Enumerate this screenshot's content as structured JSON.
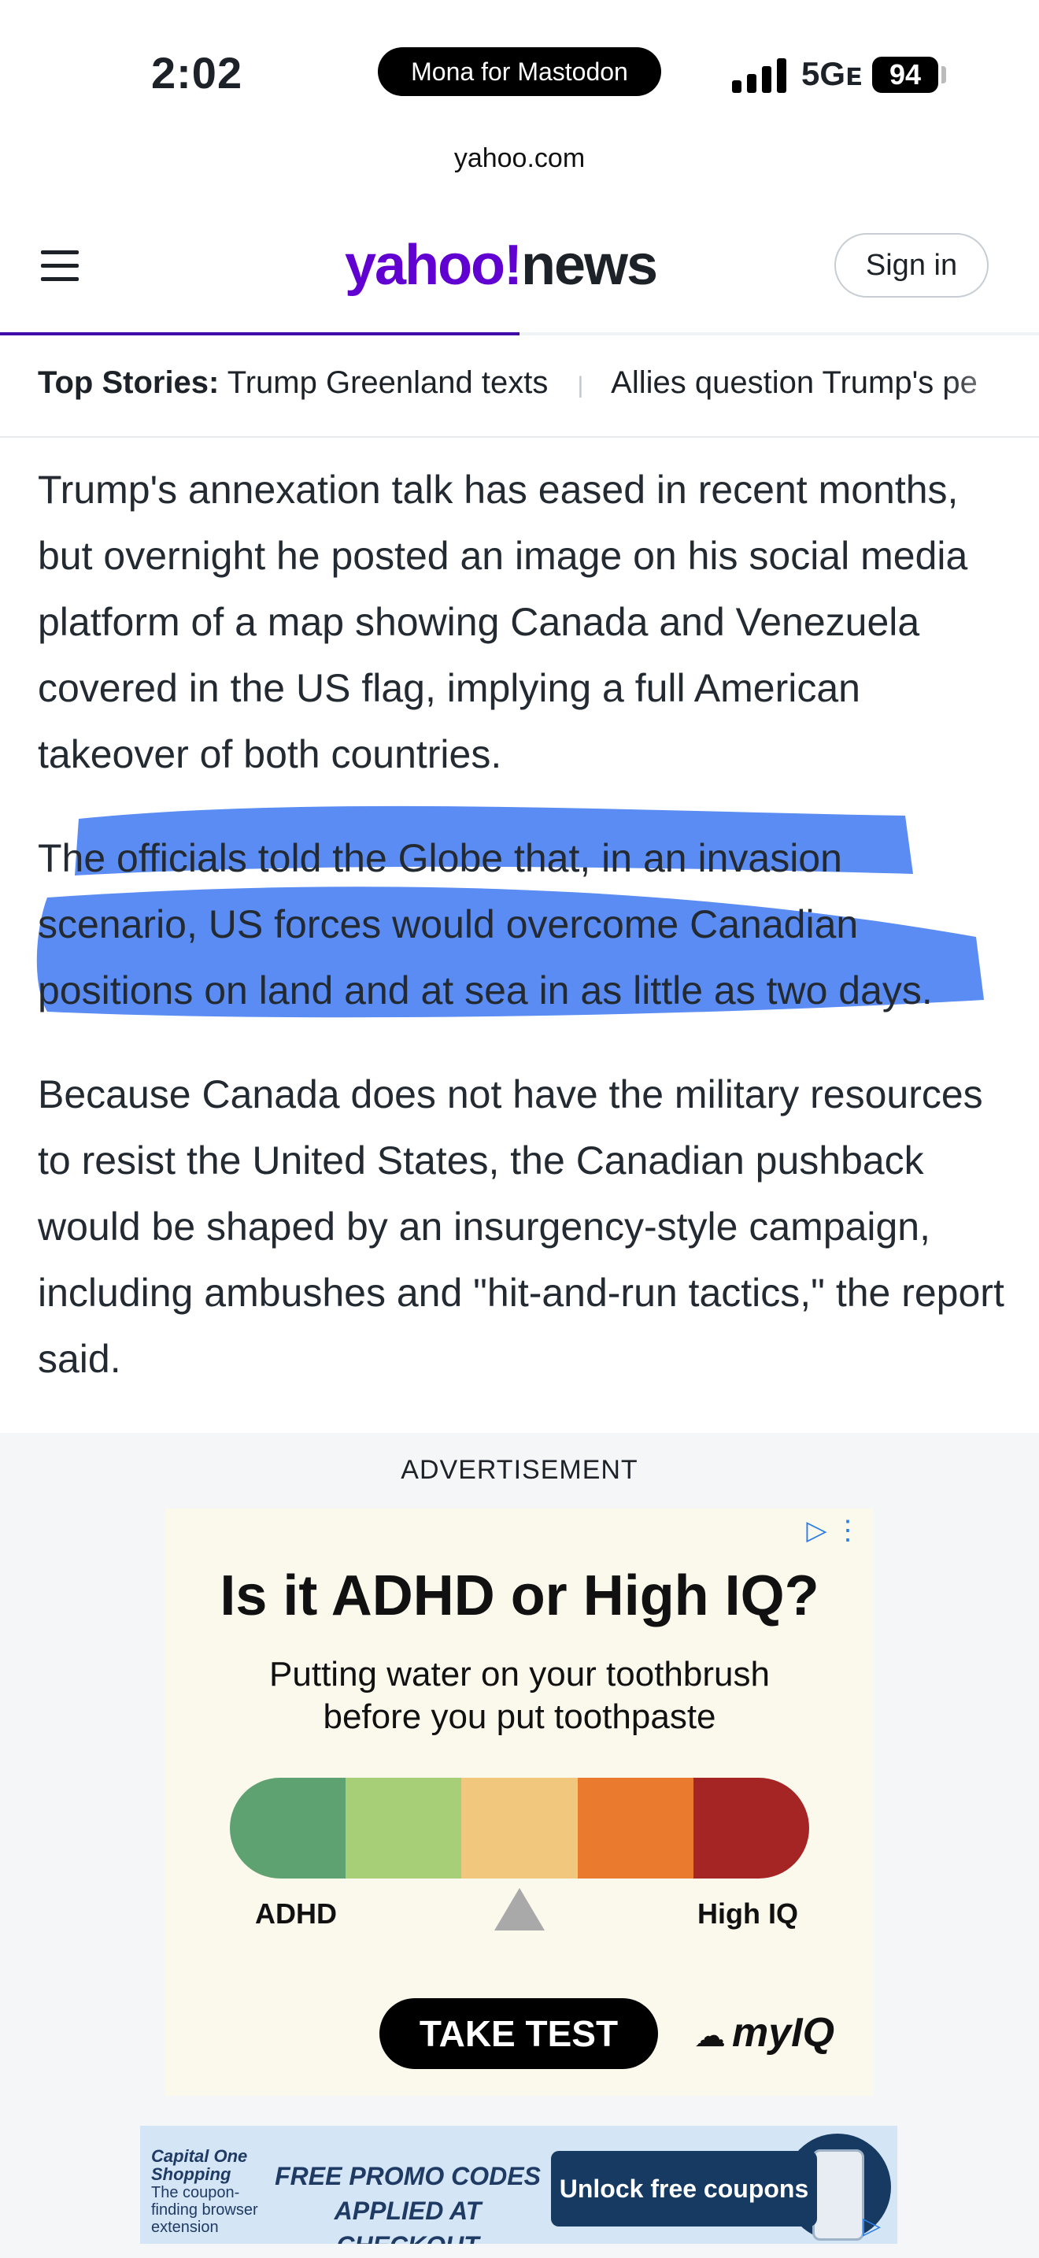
{
  "status_bar": {
    "time": "2:02",
    "app_pill": "Mona for Mastodon",
    "network": "5Gᴇ",
    "battery": "94"
  },
  "browser": {
    "url": "yahoo.com"
  },
  "header": {
    "logo_yahoo": "yahoo!",
    "logo_news": "news",
    "signin_label": "Sign in",
    "brand_color": "#6001d2",
    "reading_progress": 0.5
  },
  "top_stories": {
    "label": "Top Stories:",
    "items": [
      "Trump Greenland texts",
      "Allies question Trump's pe"
    ]
  },
  "article": {
    "paragraphs": [
      "Trump's annexation talk has eased in recent months, but overnight he posted an image on his social media platform of a map showing Canada and Venezuela covered in the US flag, implying a full American takeover of both countries.",
      "The officials told the Globe that, in an invasion scenario, US forces would overcome Canadian positions on land and at sea in as little as two days.",
      "Because Canada does not have the military resources to resist the United States, the Canadian pushback would be shaped by an insurgency-style campaign, including ambushes and \"hit-and-run tactics,\" the report said."
    ],
    "highlight_color": "#2b6bf0"
  },
  "ad": {
    "label": "ADVERTISEMENT",
    "title": "Is it ADHD or High IQ?",
    "subtitle_line1": "Putting water on your toothbrush",
    "subtitle_line2": "before you put toothpaste",
    "left_label": "ADHD",
    "right_label": "High IQ",
    "cta": "TAKE TEST",
    "brand_prefix": "my",
    "brand_suffix": "IQ",
    "meter_colors": [
      "#5ea272",
      "#a6cf78",
      "#f0c77c",
      "#ea7b2e",
      "#a52525"
    ]
  },
  "banner": {
    "brand": "Capital One Shopping",
    "tagline": "The coupon-finding browser extension",
    "promo_line1": "FREE PROMO CODES",
    "promo_line2": "APPLIED AT CHECKOUT",
    "cta": "Unlock free coupons"
  }
}
